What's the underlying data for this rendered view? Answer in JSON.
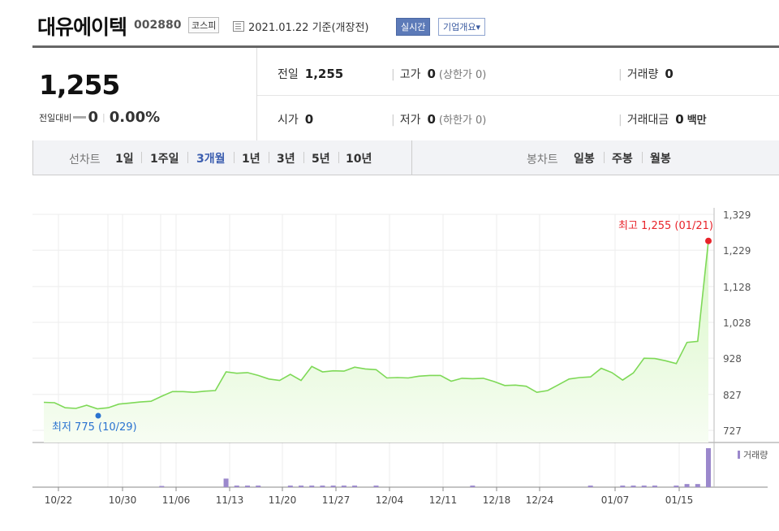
{
  "header": {
    "company": "대유에이텍",
    "code": "002880",
    "market": "코스피",
    "date": "2021.01.22 기준(개장전)",
    "btn_realtime": "실시간",
    "btn_company": "기업개요▾"
  },
  "quote": {
    "price": "1,255",
    "change_label": "전일대비",
    "change": "0",
    "change_pct": "0.00%",
    "prev_label": "전일",
    "prev": "1,255",
    "high_label": "고가",
    "high": "0",
    "high_sub": "(상한가 0)",
    "volume_label": "거래량",
    "volume": "0",
    "open_label": "시가",
    "open": "0",
    "low_label": "저가",
    "low": "0",
    "low_sub": "(하한가 0)",
    "amount_label": "거래대금",
    "amount": "0",
    "amount_unit": "백만"
  },
  "periods": {
    "line_label": "선차트",
    "line_items": [
      "1일",
      "1주일",
      "3개월",
      "1년",
      "3년",
      "5년",
      "10년"
    ],
    "active": "3개월",
    "candle_label": "봉차트",
    "candle_items": [
      "일봉",
      "주봉",
      "월봉"
    ]
  },
  "colors": {
    "line": "#7ed957",
    "fill": "#ebfbe2",
    "max": "#e8232a",
    "min": "#2a73d0",
    "vol": "#9b88cc",
    "active": "#3d5fb0"
  },
  "chart_data": {
    "type": "area",
    "y_ticks": [
      1329,
      1229,
      1128,
      1028,
      928,
      827,
      727
    ],
    "ylim": [
      727,
      1329
    ],
    "x_ticks": [
      "10/22",
      "10/30",
      "11/06",
      "11/13",
      "11/20",
      "11/27",
      "12/04",
      "12/11",
      "12/18",
      "12/24",
      "01/07",
      "01/15"
    ],
    "max_label": "최고 1,255 (01/21)",
    "min_label": "최저 775 (10/29)",
    "max_point": {
      "date": "01/21",
      "value": 1255
    },
    "min_point": {
      "date": "10/29",
      "value": 775
    },
    "volume_legend": "거래량",
    "price": [
      805,
      804,
      790,
      788,
      797,
      787,
      790,
      800,
      803,
      806,
      808,
      822,
      835,
      835,
      833,
      836,
      838,
      890,
      886,
      888,
      880,
      870,
      866,
      883,
      866,
      905,
      890,
      893,
      892,
      903,
      898,
      896,
      873,
      874,
      873,
      878,
      880,
      880,
      864,
      872,
      871,
      872,
      863,
      852,
      853,
      850,
      833,
      838,
      854,
      870,
      874,
      876,
      900,
      888,
      867,
      887,
      928,
      927,
      921,
      913,
      972,
      975,
      1255
    ],
    "volume": [
      0,
      0,
      0,
      0,
      0,
      0,
      0,
      0,
      0,
      0,
      0,
      3,
      0,
      0,
      0,
      0,
      0,
      22,
      4,
      4,
      4,
      0,
      0,
      4,
      4,
      4,
      4,
      4,
      4,
      4,
      0,
      4,
      0,
      0,
      0,
      0,
      0,
      0,
      0,
      0,
      4,
      0,
      0,
      0,
      0,
      0,
      0,
      0,
      0,
      0,
      0,
      4,
      0,
      0,
      4,
      4,
      4,
      4,
      0,
      4,
      8,
      8,
      100
    ]
  }
}
